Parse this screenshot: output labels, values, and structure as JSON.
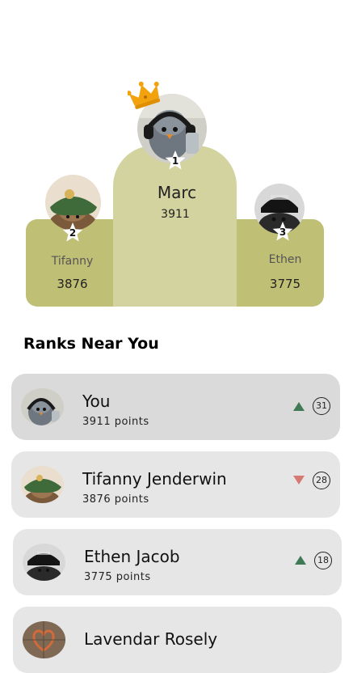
{
  "podium": {
    "first": {
      "rank": "1",
      "name": "Marc",
      "score": "3911"
    },
    "second": {
      "rank": "2",
      "name": "Tifanny",
      "score": "3876"
    },
    "third": {
      "rank": "3",
      "name": "Ethen",
      "score": "3775"
    }
  },
  "section": {
    "title": "Ranks Near You"
  },
  "ranks": [
    {
      "name": "You",
      "points": "3911 points",
      "trend": "up",
      "rank": "31"
    },
    {
      "name": "Tifanny Jenderwin",
      "points": "3876 points",
      "trend": "down",
      "rank": "28"
    },
    {
      "name": "Ethen Jacob",
      "points": "3775 points",
      "trend": "up",
      "rank": "18"
    },
    {
      "name": "Lavendar Rosely",
      "points": "",
      "trend": "",
      "rank": ""
    }
  ],
  "colors": {
    "podium_side": "#bfbf75",
    "podium_center": "#d3d3a0",
    "card_background": "#e6e6e6",
    "trend_up": "#3f7a55",
    "trend_down": "#d47a72",
    "crown": "#f2a20c"
  },
  "icons": [
    "crown-icon",
    "star-badge-icon",
    "trend-up-icon",
    "trend-down-icon"
  ]
}
